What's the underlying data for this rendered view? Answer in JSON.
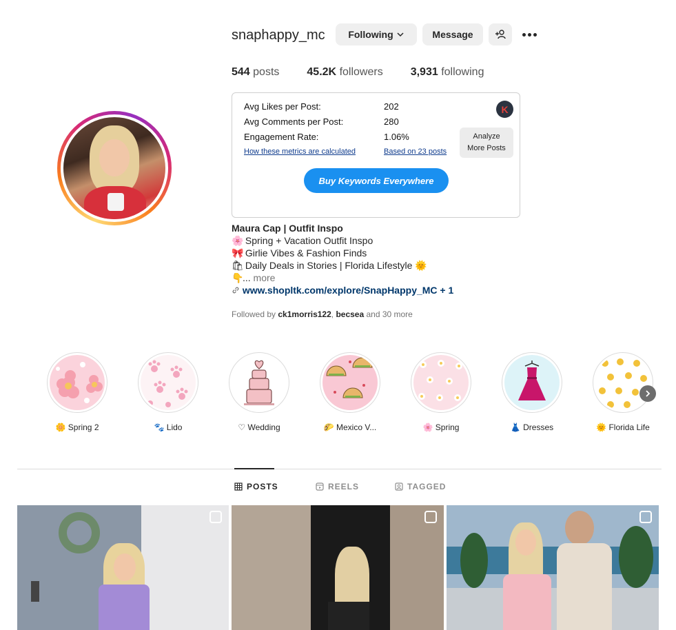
{
  "profile": {
    "username": "snaphappy_mc",
    "following_btn": "Following",
    "message_btn": "Message",
    "stats": {
      "posts_count": "544",
      "posts_label": "posts",
      "followers_count": "45.2K",
      "followers_label": "followers",
      "following_count": "3,931",
      "following_label": "following"
    }
  },
  "metrics": {
    "likes_label": "Avg Likes per Post:",
    "likes_value": "202",
    "comments_label": "Avg Comments per Post:",
    "comments_value": "280",
    "engagement_label": "Engagement Rate:",
    "engagement_value": "1.06%",
    "how_link": "How these metrics are calculated",
    "based_link": "Based on 23 posts",
    "analyze_line1": "Analyze",
    "analyze_line2": "More Posts",
    "logo_letter": "K",
    "buy_button": "Buy Keywords Everywhere"
  },
  "bio": {
    "name": "Maura Cap | Outfit Inspo",
    "line1_emoji": "🌸",
    "line1": "Spring + Vacation Outfit Inspo",
    "line2_emoji": "🎀",
    "line2": "Girlie Vibes & Fashion Finds",
    "line3_emoji": "🛍",
    "line3": "Daily Deals in Stories | Florida Lifestyle",
    "line3_end_emoji": "🌞",
    "line4_emoji": "👇",
    "line4": "...",
    "more": " more",
    "link": "www.shopltk.com/explore/SnapHappy_MC + 1",
    "followed_prefix": "Followed by ",
    "followed_user1": "ck1morris122",
    "followed_sep": ", ",
    "followed_user2": "becsea",
    "followed_suffix": " and 30 more"
  },
  "highlights": [
    {
      "emoji": "🌼",
      "label": "Spring 2"
    },
    {
      "emoji": "🐾",
      "label": "Lido"
    },
    {
      "emoji": "♡",
      "label": "Wedding"
    },
    {
      "emoji": "🌮",
      "label": "Mexico V..."
    },
    {
      "emoji": "🌸",
      "label": "Spring"
    },
    {
      "emoji": "👗",
      "label": "Dresses"
    },
    {
      "emoji": "🌞",
      "label": "Florida Life"
    }
  ],
  "tabs": {
    "posts": "POSTS",
    "reels": "REELS",
    "tagged": "TAGGED"
  },
  "colors": {
    "accent": "#1a90f0",
    "link": "#00376b"
  }
}
